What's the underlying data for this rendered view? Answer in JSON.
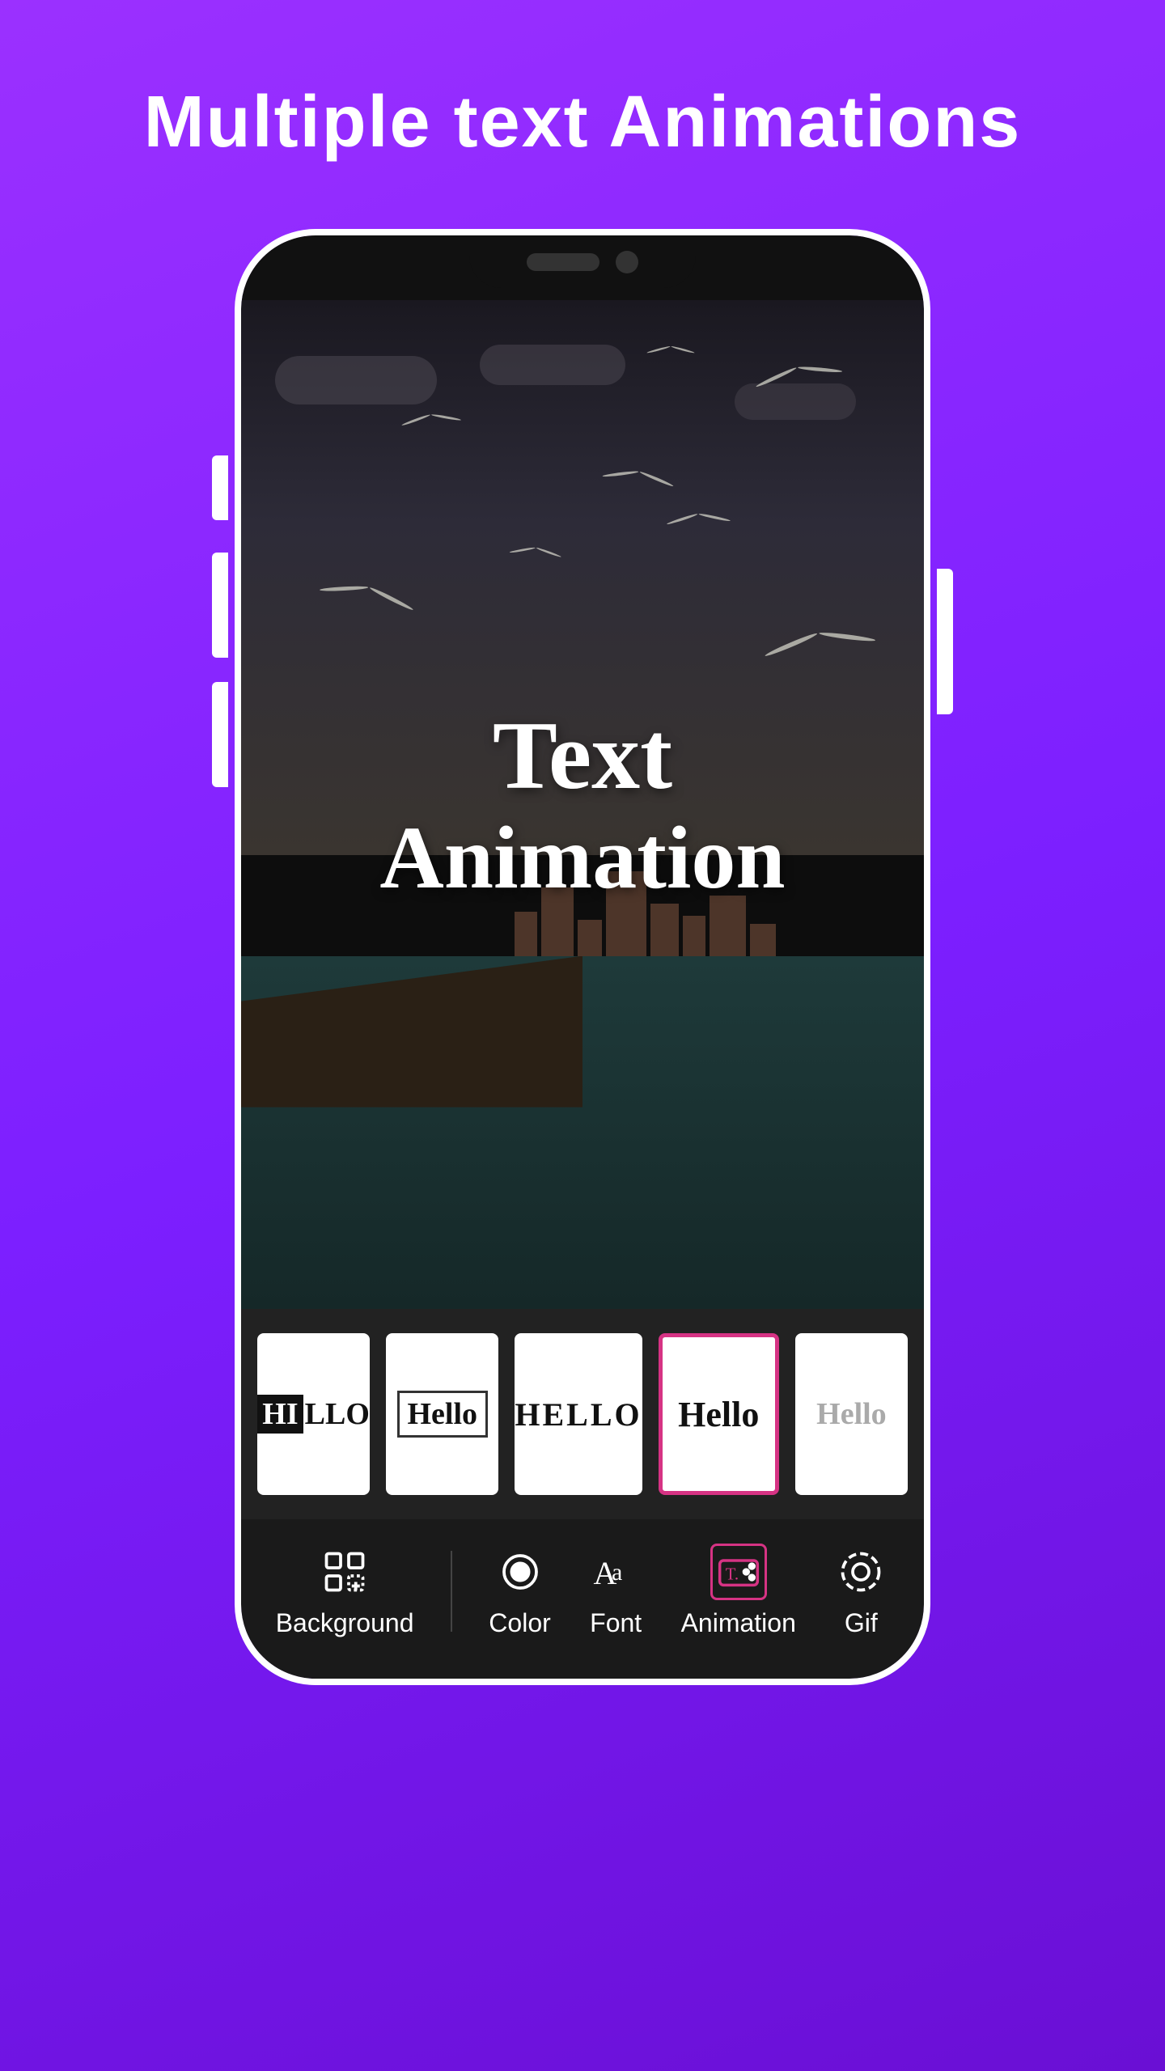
{
  "page": {
    "title": "Multiple text Animations",
    "background_gradient_start": "#9b30ff",
    "background_gradient_end": "#6a0fd4"
  },
  "phone": {
    "screen_text_line1": "Text",
    "screen_text_line2": "Animation"
  },
  "style_options": [
    {
      "id": "block-highlight",
      "display_text": "HELLO",
      "variant": "block-highlight",
      "selected": false
    },
    {
      "id": "boxed",
      "display_text": "Hello",
      "variant": "boxed",
      "selected": false
    },
    {
      "id": "uppercase",
      "display_text": "HELLO",
      "variant": "uppercase",
      "selected": false
    },
    {
      "id": "serif-bold",
      "display_text": "Hello",
      "variant": "serif-bold",
      "selected": true
    },
    {
      "id": "light",
      "display_text": "Hello",
      "variant": "light",
      "selected": false
    }
  ],
  "bottom_nav": [
    {
      "id": "background",
      "label": "Background",
      "icon": "grid-add-icon",
      "active": true
    },
    {
      "id": "color",
      "label": "Color",
      "icon": "circle-icon",
      "active": false
    },
    {
      "id": "font",
      "label": "Font",
      "icon": "font-icon",
      "active": false
    },
    {
      "id": "animation",
      "label": "Animation",
      "icon": "text-animation-icon",
      "active": false,
      "highlighted": true
    },
    {
      "id": "gif",
      "label": "Gif",
      "icon": "circle-dashed-icon",
      "active": false
    }
  ]
}
